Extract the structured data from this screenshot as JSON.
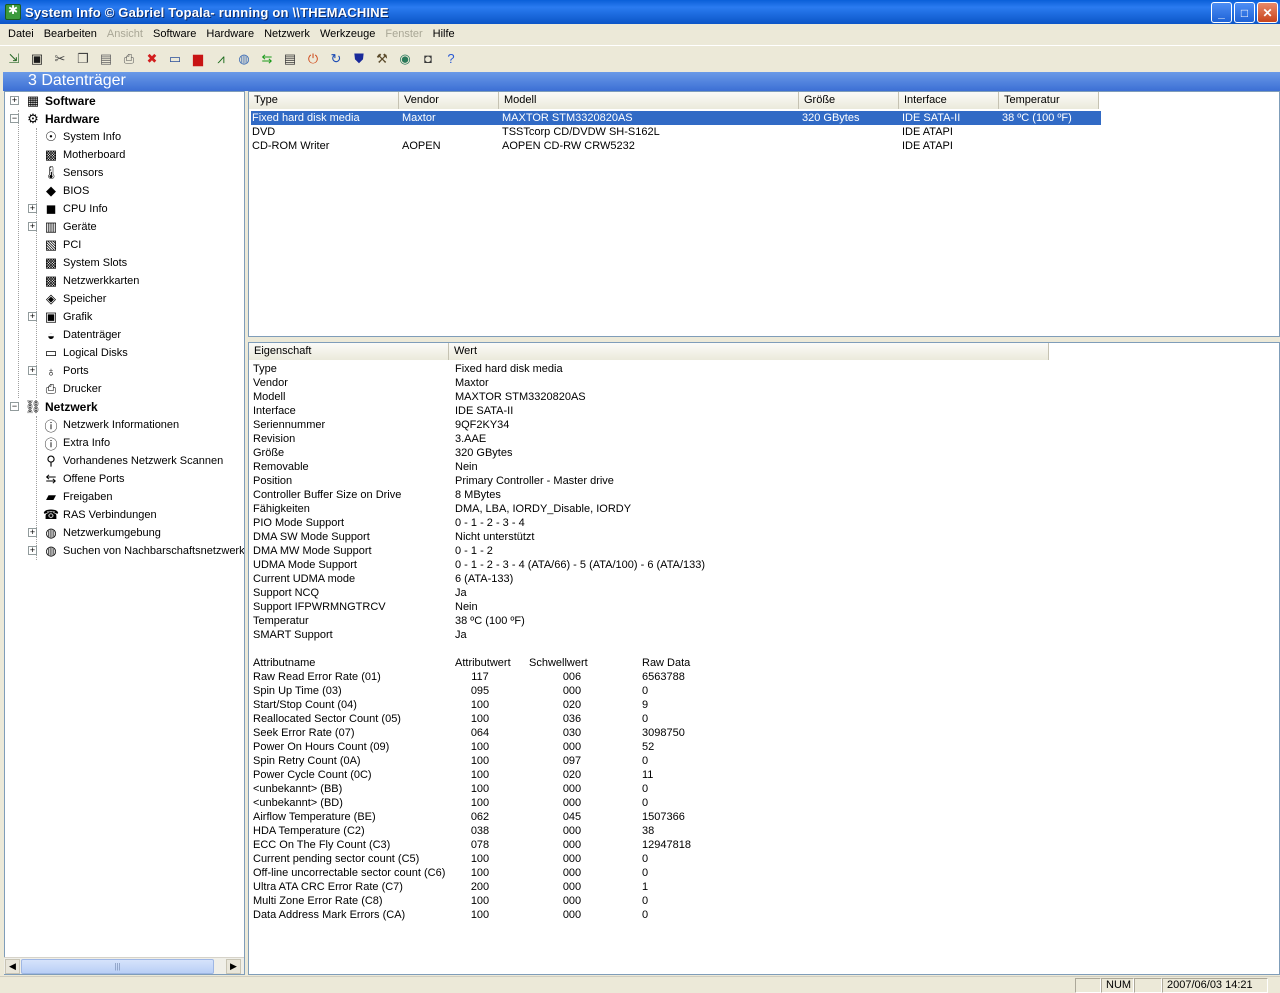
{
  "window": {
    "title": "System Info  © Gabriel Topala- running on \\\\THEMACHINE",
    "minimize": "_",
    "maximize": "□",
    "close": "✕"
  },
  "menu": [
    {
      "label": "Datei",
      "enabled": true
    },
    {
      "label": "Bearbeiten",
      "enabled": true
    },
    {
      "label": "Ansicht",
      "enabled": false
    },
    {
      "label": "Software",
      "enabled": true
    },
    {
      "label": "Hardware",
      "enabled": true
    },
    {
      "label": "Netzwerk",
      "enabled": true
    },
    {
      "label": "Werkzeuge",
      "enabled": true
    },
    {
      "label": "Fenster",
      "enabled": false
    },
    {
      "label": "Hilfe",
      "enabled": true
    }
  ],
  "toolbar": [
    {
      "icon": "export-icon",
      "glyph": "⇲",
      "color": "#2a6a2a"
    },
    {
      "icon": "save-icon",
      "glyph": "▣",
      "color": "#1a1a1a"
    },
    {
      "icon": "cut-icon",
      "glyph": "✂",
      "color": "#444444"
    },
    {
      "icon": "copy-icon",
      "glyph": "❐",
      "color": "#444444"
    },
    {
      "icon": "paste-icon",
      "glyph": "▤",
      "color": "#666666"
    },
    {
      "icon": "print-icon",
      "glyph": "⎙",
      "color": "#555555"
    },
    {
      "icon": "stop-icon",
      "glyph": "✖",
      "color": "#d21e1e"
    },
    {
      "icon": "display-icon",
      "glyph": "▭",
      "color": "#2a4f9a"
    },
    {
      "icon": "flag-icon",
      "glyph": "▆",
      "color": "#c81414"
    },
    {
      "icon": "graph-icon",
      "glyph": "⩘",
      "color": "#1a6a1a"
    },
    {
      "icon": "globe-icon",
      "glyph": "◍",
      "color": "#3a6ab4"
    },
    {
      "icon": "transfer-icon",
      "glyph": "⇆",
      "color": "#1a9a1a"
    },
    {
      "icon": "document-icon",
      "glyph": "▤",
      "color": "#3a3a3a"
    },
    {
      "icon": "power-icon",
      "glyph": "⏻",
      "color": "#d04a1a"
    },
    {
      "icon": "refresh-icon",
      "glyph": "↻",
      "color": "#1a4ab4"
    },
    {
      "icon": "shield-icon",
      "glyph": "⛊",
      "color": "#1a2a9a"
    },
    {
      "icon": "tools-icon",
      "glyph": "⚒",
      "color": "#5a4a2a"
    },
    {
      "icon": "network-icon",
      "glyph": "◉",
      "color": "#2a7a5a"
    },
    {
      "icon": "camera-icon",
      "glyph": "◘",
      "color": "#3a3a3a"
    },
    {
      "icon": "help-icon",
      "glyph": "?",
      "color": "#2a5ad4"
    }
  ],
  "caption": "3 Datenträger",
  "tree": [
    {
      "label": "Software",
      "icon": "software-icon",
      "glyph": "▦",
      "bold": true,
      "level": 0,
      "expander": "+"
    },
    {
      "label": "Hardware",
      "icon": "hardware-icon",
      "glyph": "⚙",
      "bold": true,
      "level": 0,
      "expander": "−"
    },
    {
      "label": "System Info",
      "icon": "system-info-icon",
      "glyph": "☉",
      "bold": false,
      "level": 1,
      "expander": ""
    },
    {
      "label": "Motherboard",
      "icon": "motherboard-icon",
      "glyph": "▩",
      "bold": false,
      "level": 1,
      "expander": ""
    },
    {
      "label": "Sensors",
      "icon": "thermometer-icon",
      "glyph": "🌡",
      "bold": false,
      "level": 1,
      "expander": ""
    },
    {
      "label": "BIOS",
      "icon": "chip-icon",
      "glyph": "◆",
      "bold": false,
      "level": 1,
      "expander": ""
    },
    {
      "label": "CPU Info",
      "icon": "cpu-icon",
      "glyph": "◼",
      "bold": false,
      "level": 1,
      "expander": "+"
    },
    {
      "label": "Geräte",
      "icon": "devices-icon",
      "glyph": "▥",
      "bold": false,
      "level": 1,
      "expander": "+"
    },
    {
      "label": "PCI",
      "icon": "pci-icon",
      "glyph": "▧",
      "bold": false,
      "level": 1,
      "expander": ""
    },
    {
      "label": "System Slots",
      "icon": "slots-icon",
      "glyph": "▩",
      "bold": false,
      "level": 1,
      "expander": ""
    },
    {
      "label": "Netzwerkkarten",
      "icon": "network-card-icon",
      "glyph": "▩",
      "bold": false,
      "level": 1,
      "expander": ""
    },
    {
      "label": "Speicher",
      "icon": "memory-icon",
      "glyph": "◈",
      "bold": false,
      "level": 1,
      "expander": ""
    },
    {
      "label": "Grafik",
      "icon": "graphics-icon",
      "glyph": "▣",
      "bold": false,
      "level": 1,
      "expander": "+"
    },
    {
      "label": "Datenträger",
      "icon": "disk-icon",
      "glyph": "◒",
      "bold": false,
      "level": 1,
      "expander": ""
    },
    {
      "label": "Logical Disks",
      "icon": "logical-disk-icon",
      "glyph": "▭",
      "bold": false,
      "level": 1,
      "expander": ""
    },
    {
      "label": "Ports",
      "icon": "ports-icon",
      "glyph": "♁",
      "bold": false,
      "level": 1,
      "expander": "+"
    },
    {
      "label": "Drucker",
      "icon": "printer-icon",
      "glyph": "⎙",
      "bold": false,
      "level": 1,
      "expander": ""
    },
    {
      "label": "Netzwerk",
      "icon": "network-icon",
      "glyph": "⛓",
      "bold": true,
      "level": 0,
      "expander": "−"
    },
    {
      "label": "Netzwerk Informationen",
      "icon": "info-icon",
      "glyph": "ⓘ",
      "bold": false,
      "level": 1,
      "expander": ""
    },
    {
      "label": "Extra Info",
      "icon": "info-icon",
      "glyph": "ⓘ",
      "bold": false,
      "level": 1,
      "expander": ""
    },
    {
      "label": "Vorhandenes Netzwerk Scannen",
      "icon": "scan-icon",
      "glyph": "⚲",
      "bold": false,
      "level": 1,
      "expander": ""
    },
    {
      "label": "Offene Ports",
      "icon": "arrows-icon",
      "glyph": "⇆",
      "bold": false,
      "level": 1,
      "expander": ""
    },
    {
      "label": "Freigaben",
      "icon": "folder-icon",
      "glyph": "▰",
      "bold": false,
      "level": 1,
      "expander": ""
    },
    {
      "label": "RAS Verbindungen",
      "icon": "ras-icon",
      "glyph": "☎",
      "bold": false,
      "level": 1,
      "expander": ""
    },
    {
      "label": "Netzwerkumgebung",
      "icon": "globe-icon",
      "glyph": "◍",
      "bold": false,
      "level": 1,
      "expander": "+"
    },
    {
      "label": "Suchen von Nachbarschaftsnetzwerk",
      "icon": "globe-icon",
      "glyph": "◍",
      "bold": false,
      "level": 1,
      "expander": "+"
    }
  ],
  "drives": {
    "columns": [
      "Type",
      "Vendor",
      "Modell",
      "Größe",
      "Interface",
      "Temperatur"
    ],
    "rows": [
      {
        "type": "Fixed hard disk media",
        "vendor": "Maxtor",
        "model": "MAXTOR STM3320820AS",
        "size": "320 GBytes",
        "interface": "IDE SATA-II",
        "temperature": "38 ºC (100 ºF)",
        "selected": true
      },
      {
        "type": "DVD",
        "vendor": "",
        "model": "TSSTcorp CD/DVDW SH-S162L",
        "size": "",
        "interface": "IDE ATAPI",
        "temperature": "",
        "selected": false
      },
      {
        "type": "CD-ROM Writer",
        "vendor": "AOPEN",
        "model": "AOPEN CD-RW CRW5232",
        "size": "",
        "interface": "IDE ATAPI",
        "temperature": "",
        "selected": false
      }
    ]
  },
  "details": {
    "columns": [
      "Eigenschaft",
      "Wert"
    ],
    "properties": [
      {
        "name": "Type",
        "value": "Fixed hard disk media"
      },
      {
        "name": "Vendor",
        "value": "Maxtor"
      },
      {
        "name": "Modell",
        "value": "MAXTOR STM3320820AS"
      },
      {
        "name": "Interface",
        "value": "IDE SATA-II"
      },
      {
        "name": "Seriennummer",
        "value": "9QF2KY34"
      },
      {
        "name": "Revision",
        "value": "3.AAE"
      },
      {
        "name": "Größe",
        "value": "320 GBytes"
      },
      {
        "name": "Removable",
        "value": "Nein"
      },
      {
        "name": "Position",
        "value": "Primary Controller - Master drive"
      },
      {
        "name": "Controller Buffer Size on Drive",
        "value": "8 MBytes"
      },
      {
        "name": "Fähigkeiten",
        "value": "DMA, LBA, IORDY_Disable, IORDY"
      },
      {
        "name": "PIO Mode Support",
        "value": "0 - 1 - 2 - 3 - 4"
      },
      {
        "name": "DMA SW Mode Support",
        "value": "Nicht unterstützt"
      },
      {
        "name": "DMA MW Mode Support",
        "value": "0 - 1 - 2"
      },
      {
        "name": "UDMA Mode Support",
        "value": "0 - 1 - 2 - 3 - 4 (ATA/66) - 5 (ATA/100) - 6 (ATA/133)"
      },
      {
        "name": "Current UDMA mode",
        "value": "6 (ATA-133)"
      },
      {
        "name": "Support NCQ",
        "value": "Ja"
      },
      {
        "name": "Support IFPWRMNGTRCV",
        "value": "Nein"
      },
      {
        "name": "Temperatur",
        "value": "38 ºC (100 ºF)"
      },
      {
        "name": "SMART Support",
        "value": "Ja"
      }
    ],
    "attribute_header": {
      "name": "Attributname",
      "value": "Attributwert",
      "threshold": "Schwellwert",
      "raw": "Raw Data"
    },
    "attributes": [
      {
        "name": "Raw Read Error Rate (01)",
        "value": "117",
        "threshold": "006",
        "raw": "6563788"
      },
      {
        "name": "Spin Up Time (03)",
        "value": "095",
        "threshold": "000",
        "raw": "0"
      },
      {
        "name": "Start/Stop Count (04)",
        "value": "100",
        "threshold": "020",
        "raw": "9"
      },
      {
        "name": "Reallocated Sector Count (05)",
        "value": "100",
        "threshold": "036",
        "raw": "0"
      },
      {
        "name": "Seek Error Rate (07)",
        "value": "064",
        "threshold": "030",
        "raw": "3098750"
      },
      {
        "name": "Power On Hours Count (09)",
        "value": "100",
        "threshold": "000",
        "raw": "52"
      },
      {
        "name": "Spin Retry Count (0A)",
        "value": "100",
        "threshold": "097",
        "raw": "0"
      },
      {
        "name": "Power Cycle Count (0C)",
        "value": "100",
        "threshold": "020",
        "raw": "11"
      },
      {
        "name": "<unbekannt> (BB)",
        "value": "100",
        "threshold": "000",
        "raw": "0"
      },
      {
        "name": "<unbekannt> (BD)",
        "value": "100",
        "threshold": "000",
        "raw": "0"
      },
      {
        "name": "Airflow Temperature (BE)",
        "value": "062",
        "threshold": "045",
        "raw": "1507366"
      },
      {
        "name": "HDA Temperature (C2)",
        "value": "038",
        "threshold": "000",
        "raw": "38"
      },
      {
        "name": "ECC On The Fly Count (C3)",
        "value": "078",
        "threshold": "000",
        "raw": "12947818"
      },
      {
        "name": "Current pending sector count (C5)",
        "value": "100",
        "threshold": "000",
        "raw": "0"
      },
      {
        "name": "Off-line uncorrectable sector count (C6)",
        "value": "100",
        "threshold": "000",
        "raw": "0"
      },
      {
        "name": "Ultra ATA CRC Error Rate (C7)",
        "value": "200",
        "threshold": "000",
        "raw": "1"
      },
      {
        "name": "Multi Zone Error Rate (C8)",
        "value": "100",
        "threshold": "000",
        "raw": "0"
      },
      {
        "name": "Data Address Mark Errors (CA)",
        "value": "100",
        "threshold": "000",
        "raw": "0"
      }
    ]
  },
  "status": {
    "num": "NUM",
    "datetime": "2007/06/03 14:21"
  },
  "scrollbar": {
    "left_arrow": "◀",
    "right_arrow": "▶",
    "grip": "|||"
  },
  "colors": {
    "selection": "#316ac5",
    "titlebar": "#0a5fd8",
    "caption": "#3c6fd4"
  }
}
